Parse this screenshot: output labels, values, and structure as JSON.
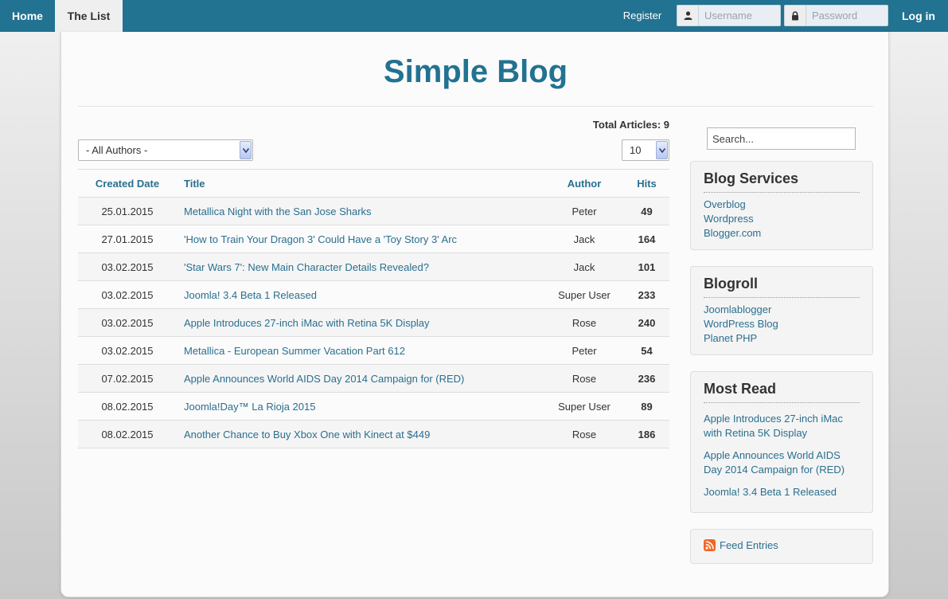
{
  "nav": {
    "home": "Home",
    "the_list": "The List",
    "register": "Register",
    "username_placeholder": "Username",
    "password_placeholder": "Password",
    "login": "Log in"
  },
  "site": {
    "title": "Simple Blog"
  },
  "list": {
    "total_articles": "Total Articles: 9",
    "author_filter": "- All Authors -",
    "limit": "10",
    "columns": {
      "date": "Created Date",
      "title": "Title",
      "author": "Author",
      "hits": "Hits"
    },
    "rows": [
      {
        "date": "25.01.2015",
        "title": "Metallica Night with the San Jose Sharks",
        "author": "Peter",
        "hits": "49"
      },
      {
        "date": "27.01.2015",
        "title": "'How to Train Your Dragon 3' Could Have a 'Toy Story 3' Arc",
        "author": "Jack",
        "hits": "164"
      },
      {
        "date": "03.02.2015",
        "title": "'Star Wars 7': New Main Character Details Revealed?",
        "author": "Jack",
        "hits": "101"
      },
      {
        "date": "03.02.2015",
        "title": "Joomla! 3.4 Beta 1 Released",
        "author": "Super User",
        "hits": "233"
      },
      {
        "date": "03.02.2015",
        "title": "Apple Introduces 27-inch iMac with Retina 5K Display",
        "author": "Rose",
        "hits": "240"
      },
      {
        "date": "03.02.2015",
        "title": "Metallica - European Summer Vacation Part 612",
        "author": "Peter",
        "hits": "54"
      },
      {
        "date": "07.02.2015",
        "title": "Apple Announces World AIDS Day 2014 Campaign for (RED)",
        "author": "Rose",
        "hits": "236"
      },
      {
        "date": "08.02.2015",
        "title": "Joomla!Day™ La Rioja 2015",
        "author": "Super User",
        "hits": "89"
      },
      {
        "date": "08.02.2015",
        "title": "Another Chance to Buy Xbox One with Kinect at $449",
        "author": "Rose",
        "hits": "186"
      }
    ]
  },
  "sidebar": {
    "search_placeholder": "Search...",
    "blog_services": {
      "title": "Blog Services",
      "items": [
        "Overblog",
        "Wordpress",
        "Blogger.com"
      ]
    },
    "blogroll": {
      "title": "Blogroll",
      "items": [
        "Joomlablogger",
        "WordPress Blog",
        "Planet PHP"
      ]
    },
    "most_read": {
      "title": "Most Read",
      "items": [
        "Apple Introduces 27-inch iMac with Retina 5K Display",
        "Apple Announces World AIDS Day 2014 Campaign for (RED)",
        "Joomla! 3.4 Beta 1 Released"
      ]
    },
    "feed": {
      "label": "Feed Entries"
    }
  },
  "icons": {
    "user": "user-icon",
    "lock": "lock-icon",
    "rss": "rss-icon",
    "dropdown": "chevron-down-icon"
  },
  "colors": {
    "accent": "#227291",
    "link": "#2a6f8f",
    "rss": "#f26522"
  }
}
